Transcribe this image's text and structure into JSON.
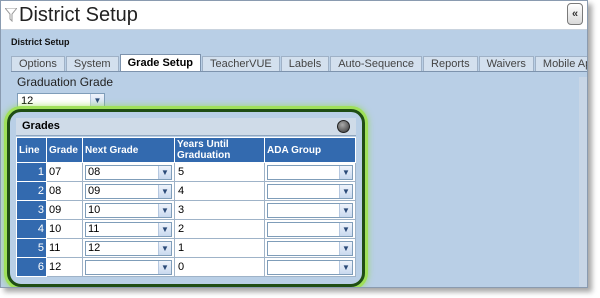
{
  "window": {
    "title": "District Setup",
    "collapse_glyph": "«"
  },
  "subtitle": "District Setup",
  "tabs": [
    {
      "label": "Options",
      "active": false
    },
    {
      "label": "System",
      "active": false
    },
    {
      "label": "Grade Setup",
      "active": true
    },
    {
      "label": "TeacherVUE",
      "active": false
    },
    {
      "label": "Labels",
      "active": false
    },
    {
      "label": "Auto-Sequence",
      "active": false
    },
    {
      "label": "Reports",
      "active": false
    },
    {
      "label": "Waivers",
      "active": false
    },
    {
      "label": "Mobile Apps",
      "active": false
    }
  ],
  "graduation": {
    "label": "Graduation Grade",
    "value": "12"
  },
  "grades": {
    "title": "Grades",
    "columns": [
      "Line",
      "Grade",
      "Next Grade",
      "Years Until Graduation",
      "ADA Group"
    ],
    "rows": [
      {
        "line": "1",
        "grade": "07",
        "next": "08",
        "years": "5",
        "ada": ""
      },
      {
        "line": "2",
        "grade": "08",
        "next": "09",
        "years": "4",
        "ada": ""
      },
      {
        "line": "3",
        "grade": "09",
        "next": "10",
        "years": "3",
        "ada": ""
      },
      {
        "line": "4",
        "grade": "10",
        "next": "11",
        "years": "2",
        "ada": ""
      },
      {
        "line": "5",
        "grade": "11",
        "next": "12",
        "years": "1",
        "ada": ""
      },
      {
        "line": "6",
        "grade": "12",
        "next": "",
        "years": "0",
        "ada": ""
      }
    ]
  },
  "icons": {
    "dropdown_arrow": "▼",
    "funnel": "filter-icon"
  }
}
